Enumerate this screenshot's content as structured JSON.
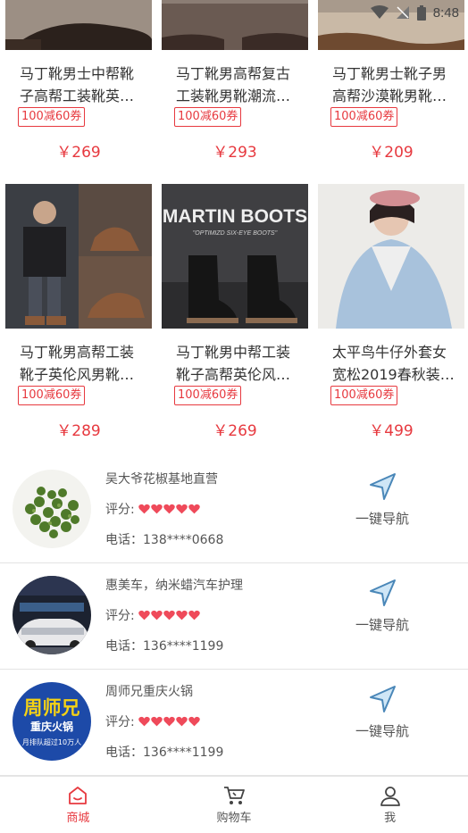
{
  "status_bar": {
    "time": "8:48"
  },
  "products": [
    {
      "title_line1": "马丁靴男士中帮靴",
      "title_line2": "子高帮工装靴英…",
      "coupon": "100减60券",
      "price": "￥269"
    },
    {
      "title_line1": "马丁靴男高帮复古",
      "title_line2": "工装靴男靴潮流…",
      "coupon": "100减60券",
      "price": "￥293"
    },
    {
      "title_line1": "马丁靴男士靴子男",
      "title_line2": "高帮沙漠靴男靴…",
      "coupon": "100减60券",
      "price": "￥209"
    },
    {
      "title_line1": "马丁靴男高帮工装",
      "title_line2": "靴子英伦风男靴…",
      "coupon": "100减60券",
      "price": "￥289"
    },
    {
      "title_line1": "马丁靴男中帮工装",
      "title_line2": "靴子高帮英伦风…",
      "coupon": "100减60券",
      "price": "￥269",
      "image_text": "MARTIN BOOTS",
      "image_subtext": "\"OPTIMIZD SIX-EYE BOOTS\""
    },
    {
      "title_line1": "太平鸟牛仔外套女",
      "title_line2": "宽松2019春秋装…",
      "coupon": "100减60券",
      "price": "￥499"
    }
  ],
  "shops": [
    {
      "name": "吴大爷花椒基地直营",
      "rating_label": "评分:",
      "rating": 5,
      "phone": "电话：138****0668",
      "nav_label": "一键导航"
    },
    {
      "name": "惠美车，纳米蜡汽车护理",
      "rating_label": "评分:",
      "rating": 5,
      "phone": "电话：136****1199",
      "nav_label": "一键导航"
    },
    {
      "name": "周师兄重庆火锅",
      "rating_label": "评分:",
      "rating": 5,
      "phone": "电话：136****1199",
      "nav_label": "一键导航",
      "logo_line1": "周师兄",
      "logo_line2": "重庆火锅",
      "logo_line3": "月排队超过10万人"
    }
  ],
  "tabbar": {
    "items": [
      {
        "label": "商城",
        "icon": "home-icon",
        "active": true
      },
      {
        "label": "购物车",
        "icon": "cart-icon",
        "active": false
      },
      {
        "label": "我",
        "icon": "user-icon",
        "active": false
      }
    ]
  },
  "colors": {
    "accent": "#e7393f",
    "text": "#333333",
    "muted": "#555555",
    "divider": "#e3e3e3",
    "heart": "#ef4a5a",
    "nav_icon_fill": "#cfe6f6",
    "nav_icon_stroke": "#4a87b8"
  }
}
